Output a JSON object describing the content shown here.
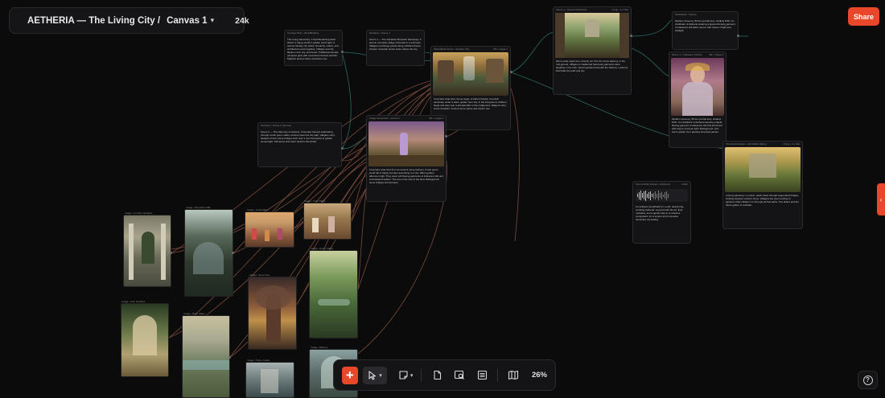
{
  "app": {
    "project_title": "AETHERIA — The Living City /",
    "canvas_name": "Canvas 1",
    "credits": "24k",
    "share_label": "Share",
    "zoom": "26%",
    "help": "?"
  },
  "toolbar": {
    "add_symbol": "+",
    "icons": [
      "plus-icon",
      "pointer-icon",
      "sticky-note-icon",
      "document-icon",
      "image-search-icon",
      "list-icon",
      "map-icon"
    ]
  },
  "colors": {
    "accent": "#e8472a",
    "canvas": "#0b0b0c",
    "panel": "#141416",
    "wire_orange": "#7a4a3a",
    "wire_teal": "#2a6b62"
  },
  "nodes": {
    "text_1": {
      "header": "Concept Brief • WorldBuilding",
      "body": "The Living Sanctuary: A Self-Sustaining Ideal World. A happy world in golden warm light. A serene fantasy city where humanity, nature, and architecture work together. Villages and city flanks a river city, and forest. Traditional wooden canopies glow with a luxurious harvest warmth. Majestic ancient stone structures rise."
    },
    "text_2": {
      "header": "Narrative • Scene 1",
      "body": "Scene 1 — The Fantastic Mountain Sanctuary. A serene mountain village shrouded in a soft haze. Villagers exchange goods along cobbled streets. Ancient mountain spires tower above the city."
    },
    "text_3": {
      "header": "Narrative • Scene 2 (Sunset)",
      "body": "Scene 2 — The Harmony of Harvest. Cinematic harvest celebrating through a lush green valley. Ancient trees line the path, villagers carry baskets of fruit, stone bridges arch over a river that glows in golden sunset light. Tall spires and warm lanterns illuminate."
    },
    "gen_main": {
      "header": "Sheet/Wide Scene • Fantasy City",
      "right": "SR • Image 1",
      "body": "Cinematic wide shot, drone angle. A vibrant fantasy mountain sanctuary under a warm golden hour sky. In the foreground, children laugh and play near a tall waterfall. In the midground, villagers carry woven baskets. Ancient stone spires and towers rise."
    },
    "gen_2": {
      "header": "Image Generation • Scene 2",
      "right": "SR • Image 2",
      "body": "Cinematic wide shot from an ancient stone balcony. A lush green world full of happy humans ascending to a city. Warm golden afternoon light. They wear soft flowing garments of iridescent silk and embroidered leather. The tree is the soul of the land. Background: stone bridges and terraces."
    },
    "gen_top": {
      "header": "Scene 1 • Ground Production",
      "right": "Living • 1:1 Slot",
      "body": "20mm wide angle lens, directly out from the stone balcony, in the mid-ground, villagers in traditional Sanctuary garments were laughing in the lush, vibrant gardens beneath the balcony. Lanterns illuminate the path and city."
    },
    "lore": {
      "header": "Worldbuild • Culture",
      "body": "Medium close-up, 85mm portrait lens, shallow DOF: An inhabitant of Aetheria wearing a layered flowing garment of iridescent silk fabric woven with traces of light and starlight."
    },
    "portrait": {
      "header": "Scene 3 • Character Portrait",
      "right": "SR • Image 3",
      "body": "Medium close-up, 85mm portrait lens, shallow DOF: An inhabitant of Aetheria wearing a liquid, flowing garment of iridescent silk that shimmers with traces of woven light. Background: soft, warm golden hour glowing botanical garden."
    },
    "landscape": {
      "header": "Scene/Landscape • Life Within Nature",
      "right": "Living • 1:1 Slot",
      "body": "A living sanctuary in motion: water flows through suspended bridges, winding between ancient stone. Villagers are seen tending to gardens while children run through arched paths. The elders and the future gather to cultivate."
    },
    "audio": {
      "header": "Sound Audio Design • Ambience",
      "right": "Audio",
      "body": "An ambient soundtrack for a soft, welcoming, soothing Aetheria. Layered with drums, flute melodies, and a gentle harp in a cohesive composition for a serene and immersive sanctuary city feeling."
    },
    "gallery": [
      {
        "label": "Image • Corridor Gardens"
      },
      {
        "label": "Image • Mountain Cliffs"
      },
      {
        "label": "Image • Celebration"
      },
      {
        "label": "Image • Town Plaza"
      },
      {
        "label": "Image • Arch Gardens"
      },
      {
        "label": "Image • River Valley"
      },
      {
        "label": "Image • Great Tree"
      },
      {
        "label": "Image • Green Valley"
      },
      {
        "label": "Image • Stone Castle"
      },
      {
        "label": "Image • Balcony"
      }
    ]
  }
}
